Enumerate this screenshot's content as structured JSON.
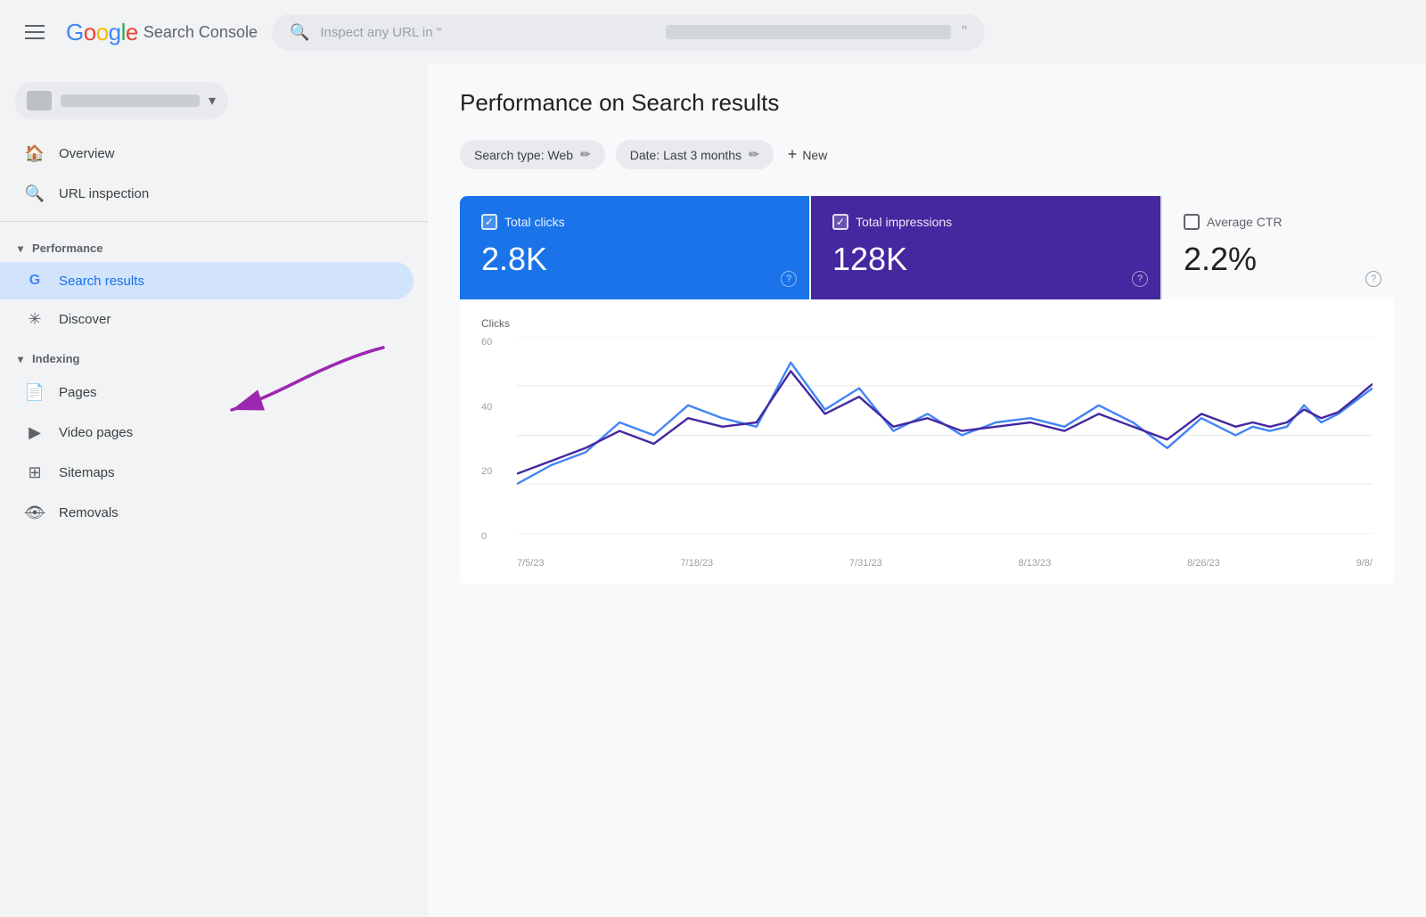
{
  "header": {
    "menu_label": "Menu",
    "logo_text": "Search Console",
    "search_placeholder": "Inspect any URL in \""
  },
  "sidebar": {
    "site_selector": {
      "label": "Site selector"
    },
    "nav_items": [
      {
        "id": "overview",
        "label": "Overview",
        "icon": "home"
      },
      {
        "id": "url-inspection",
        "label": "URL inspection",
        "icon": "search"
      }
    ],
    "sections": [
      {
        "id": "performance",
        "label": "Performance",
        "expanded": true,
        "items": [
          {
            "id": "search-results",
            "label": "Search results",
            "icon": "g-logo",
            "active": true
          },
          {
            "id": "discover",
            "label": "Discover",
            "icon": "asterisk"
          }
        ]
      },
      {
        "id": "indexing",
        "label": "Indexing",
        "expanded": true,
        "items": [
          {
            "id": "pages",
            "label": "Pages",
            "icon": "pages"
          },
          {
            "id": "video-pages",
            "label": "Video pages",
            "icon": "video"
          },
          {
            "id": "sitemaps",
            "label": "Sitemaps",
            "icon": "sitemaps"
          },
          {
            "id": "removals",
            "label": "Removals",
            "icon": "removals"
          }
        ]
      }
    ]
  },
  "main": {
    "page_title": "Performance on Search results",
    "filters": {
      "search_type": "Search type: Web",
      "date": "Date: Last 3 months",
      "new_label": "New",
      "edit_icon": "✏"
    },
    "metrics": [
      {
        "id": "total-clicks",
        "label": "Total clicks",
        "value": "2.8K",
        "theme": "blue",
        "checked": true
      },
      {
        "id": "total-impressions",
        "label": "Total impressions",
        "value": "128K",
        "theme": "purple",
        "checked": true
      },
      {
        "id": "average-ctr",
        "label": "Average CTR",
        "value": "2.2%",
        "theme": "light",
        "checked": false
      }
    ],
    "chart": {
      "y_label": "Clicks",
      "y_values": [
        "60",
        "40",
        "20",
        "0"
      ],
      "x_labels": [
        "7/5/23",
        "7/18/23",
        "7/31/23",
        "8/13/23",
        "8/26/23",
        "9/8/"
      ]
    }
  }
}
